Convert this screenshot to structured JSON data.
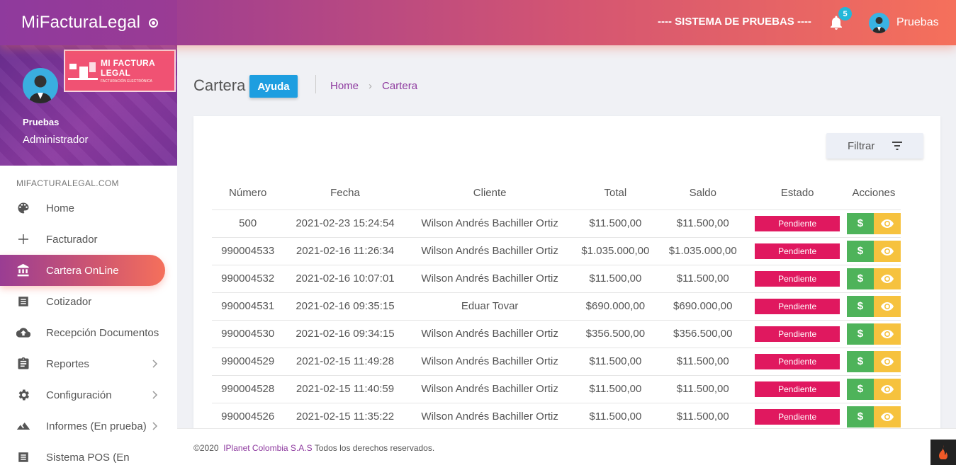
{
  "app": {
    "brand": "MiFacturaLegal",
    "system_label": "---- SISTEMA DE PRUEBAS ----",
    "notification_count": "5",
    "user": "Pruebas"
  },
  "profile": {
    "name": "Pruebas",
    "role": "Administrador",
    "logo_title": "MI FACTURA LEGAL",
    "logo_subtitle": "FACTURACIÓN ELECTRÓNICA"
  },
  "sidebar": {
    "section": "MIFACTURALEGAL.COM",
    "items": [
      {
        "label": "Home",
        "icon": "palette-icon"
      },
      {
        "label": "Facturador",
        "icon": "plus-icon"
      },
      {
        "label": "Cartera OnLine",
        "icon": "bank-icon"
      },
      {
        "label": "Cotizador",
        "icon": "list-icon"
      },
      {
        "label": "Recepción Documentos",
        "icon": "cloud-upload-icon"
      },
      {
        "label": "Reportes",
        "icon": "clipboard-icon"
      },
      {
        "label": "Configuración",
        "icon": "gear-icon"
      },
      {
        "label": "Informes (En prueba)",
        "icon": "landscape-icon"
      },
      {
        "label": "Sistema POS (En",
        "icon": "list-icon"
      }
    ]
  },
  "header": {
    "title": "Cartera",
    "help": "Ayuda",
    "breadcrumb": [
      "Home",
      "Cartera"
    ]
  },
  "filter_label": "Filtrar",
  "table": {
    "columns": [
      "Número",
      "Fecha",
      "Cliente",
      "Total",
      "Saldo",
      "Estado",
      "Acciones"
    ],
    "pay_symbol": "$",
    "rows": [
      {
        "numero": "500",
        "fecha": "2021-02-23 15:24:54",
        "cliente": "Wilson Andrés Bachiller Ortiz",
        "total": "$11.500,00",
        "saldo": "$11.500,00",
        "estado": "Pendiente"
      },
      {
        "numero": "990004533",
        "fecha": "2021-02-16 11:26:34",
        "cliente": "Wilson Andrés Bachiller Ortiz",
        "total": "$1.035.000,00",
        "saldo": "$1.035.000,00",
        "estado": "Pendiente"
      },
      {
        "numero": "990004532",
        "fecha": "2021-02-16 10:07:01",
        "cliente": "Wilson Andrés Bachiller Ortiz",
        "total": "$11.500,00",
        "saldo": "$11.500,00",
        "estado": "Pendiente"
      },
      {
        "numero": "990004531",
        "fecha": "2021-02-16 09:35:15",
        "cliente": "Eduar Tovar",
        "total": "$690.000,00",
        "saldo": "$690.000,00",
        "estado": "Pendiente"
      },
      {
        "numero": "990004530",
        "fecha": "2021-02-16 09:34:15",
        "cliente": "Wilson Andrés Bachiller Ortiz",
        "total": "$356.500,00",
        "saldo": "$356.500,00",
        "estado": "Pendiente"
      },
      {
        "numero": "990004529",
        "fecha": "2021-02-15 11:49:28",
        "cliente": "Wilson Andrés Bachiller Ortiz",
        "total": "$11.500,00",
        "saldo": "$11.500,00",
        "estado": "Pendiente"
      },
      {
        "numero": "990004528",
        "fecha": "2021-02-15 11:40:59",
        "cliente": "Wilson Andrés Bachiller Ortiz",
        "total": "$11.500,00",
        "saldo": "$11.500,00",
        "estado": "Pendiente"
      },
      {
        "numero": "990004526",
        "fecha": "2021-02-15 11:35:22",
        "cliente": "Wilson Andrés Bachiller Ortiz",
        "total": "$11.500,00",
        "saldo": "$11.500,00",
        "estado": "Pendiente"
      }
    ]
  },
  "footer": {
    "year": "©2020",
    "company": "IPlanet Colombia S.A.S",
    "rights": "Todos los derechos reservados."
  },
  "colors": {
    "accent": "#8e3a9f",
    "accent2": "#f5705b",
    "pending": "#e0185f",
    "pay": "#4eb35a",
    "view": "#f6c23e",
    "help": "#1d9ee0"
  }
}
